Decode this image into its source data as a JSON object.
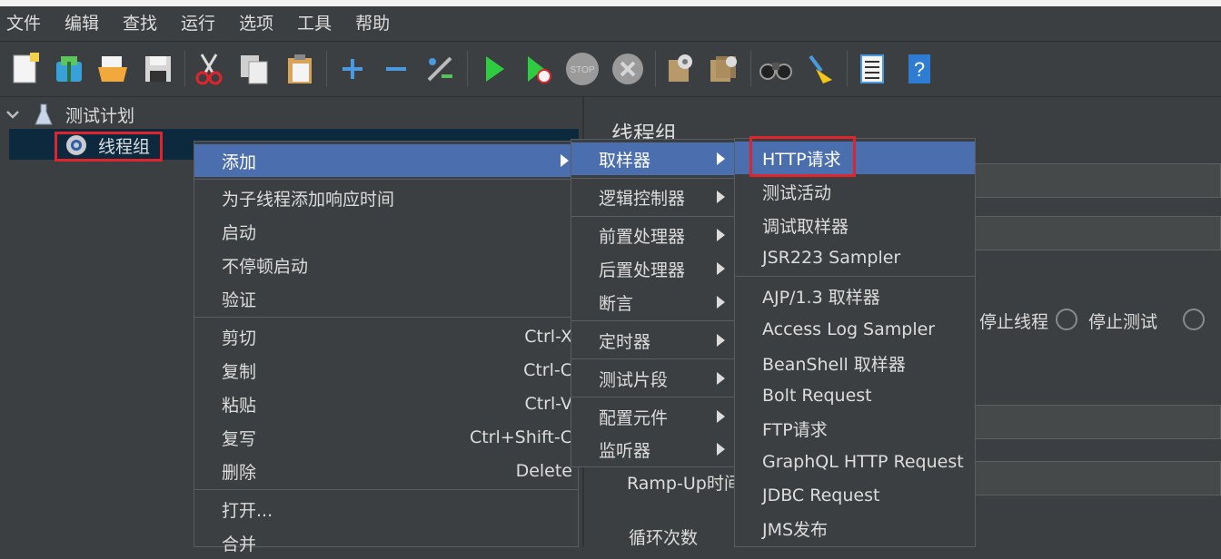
{
  "menubar": [
    "文件",
    "编辑",
    "查找",
    "运行",
    "选项",
    "工具",
    "帮助"
  ],
  "toolbar_icons": [
    "new-icon",
    "templates-icon",
    "open-icon",
    "save-icon",
    "cut-icon",
    "copy-icon",
    "paste-icon",
    "expand-icon",
    "collapse-icon",
    "toggle-icon",
    "start-icon",
    "start-no-pause-icon",
    "stop-icon",
    "shutdown-icon",
    "clear-icon",
    "clear-all-icon",
    "search-icon",
    "reset-search-icon",
    "function-helper-icon",
    "help-icon"
  ],
  "tree": {
    "root": "测试计划",
    "child": "线程组"
  },
  "panel": {
    "title": "线程组",
    "ramp_up_label": "Ramp-Up时间",
    "loop_label": "循环次数",
    "radio_stop_thread": "停止线程",
    "radio_stop_test": "停止测试"
  },
  "context_menu": {
    "add": "添加",
    "add_think_time": "为子线程添加响应时间",
    "start": "启动",
    "start_no_pause": "不停顿启动",
    "validate": "验证",
    "cut": "剪切",
    "cut_shortcut": "Ctrl-X",
    "copy": "复制",
    "copy_shortcut": "Ctrl-C",
    "paste": "粘贴",
    "paste_shortcut": "Ctrl-V",
    "duplicate": "复写",
    "duplicate_shortcut": "Ctrl+Shift-C",
    "remove": "删除",
    "remove_shortcut": "Delete",
    "open": "打开...",
    "merge": "合并"
  },
  "add_submenu": [
    "取样器",
    "逻辑控制器",
    "前置处理器",
    "后置处理器",
    "断言",
    "定时器",
    "测试片段",
    "配置元件",
    "监听器"
  ],
  "sampler_submenu": [
    "HTTP请求",
    "测试活动",
    "调试取样器",
    "JSR223 Sampler",
    "AJP/1.3 取样器",
    "Access Log Sampler",
    "BeanShell 取样器",
    "Bolt Request",
    "FTP请求",
    "GraphQL HTTP Request",
    "JDBC Request",
    "JMS发布"
  ],
  "colors": {
    "highlight": "#4b6eaf",
    "annotation": "#e0242b",
    "background": "#3c3f41"
  }
}
